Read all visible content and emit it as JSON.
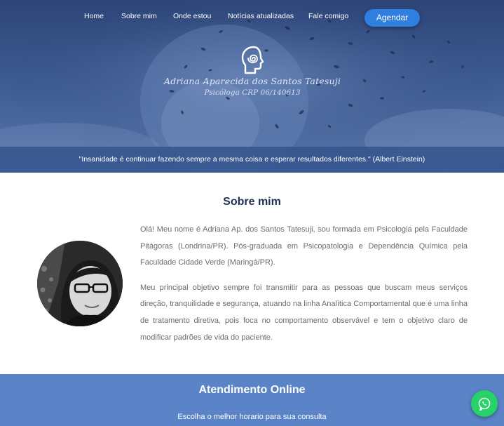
{
  "nav": {
    "items": [
      "Home",
      "Sobre mim",
      "Onde estou",
      "Notícias atualizadas",
      "Fale comigo"
    ],
    "cta_label": "Agendar"
  },
  "brand": {
    "name": "Adriana Aparecida dos Santos Tatesuji",
    "subtitle": "Psicóloga CRP 06/140613"
  },
  "hero": {
    "quote": "\"Insanidade é continuar fazendo sempre a mesma coisa e esperar resultados diferentes.\" (Albert Einstein)"
  },
  "about": {
    "title": "Sobre mim",
    "paragraphs": [
      "Olá! Meu nome é Adriana Ap. dos Santos Tatesuji, sou formada em Psicologia pela Faculdade Pitágoras (Londrina/PR). Pós-graduada em Psicopatologia e Dependência Química pela Faculdade Cidade Verde (Maringá/PR).",
      "Meu principal objetivo sempre foi transmitir para as pessoas que buscam meus serviços direção, tranquilidade e segurança, atuando na linha Analítica Comportamental que é uma linha de tratamento diretiva, pois foca no comportamento observável e tem o objetivo claro de modificar padrões de vida do paciente."
    ]
  },
  "online": {
    "title": "Atendimento Online",
    "subtitle": "Escolha o melhor horario para sua consulta"
  },
  "icons": {
    "logo": "head-spiral-logo-icon",
    "whatsapp": "whatsapp-icon"
  },
  "colors": {
    "cta": "#2f7fe0",
    "online_band": "#5b84c8",
    "whatsapp": "#25d366"
  }
}
